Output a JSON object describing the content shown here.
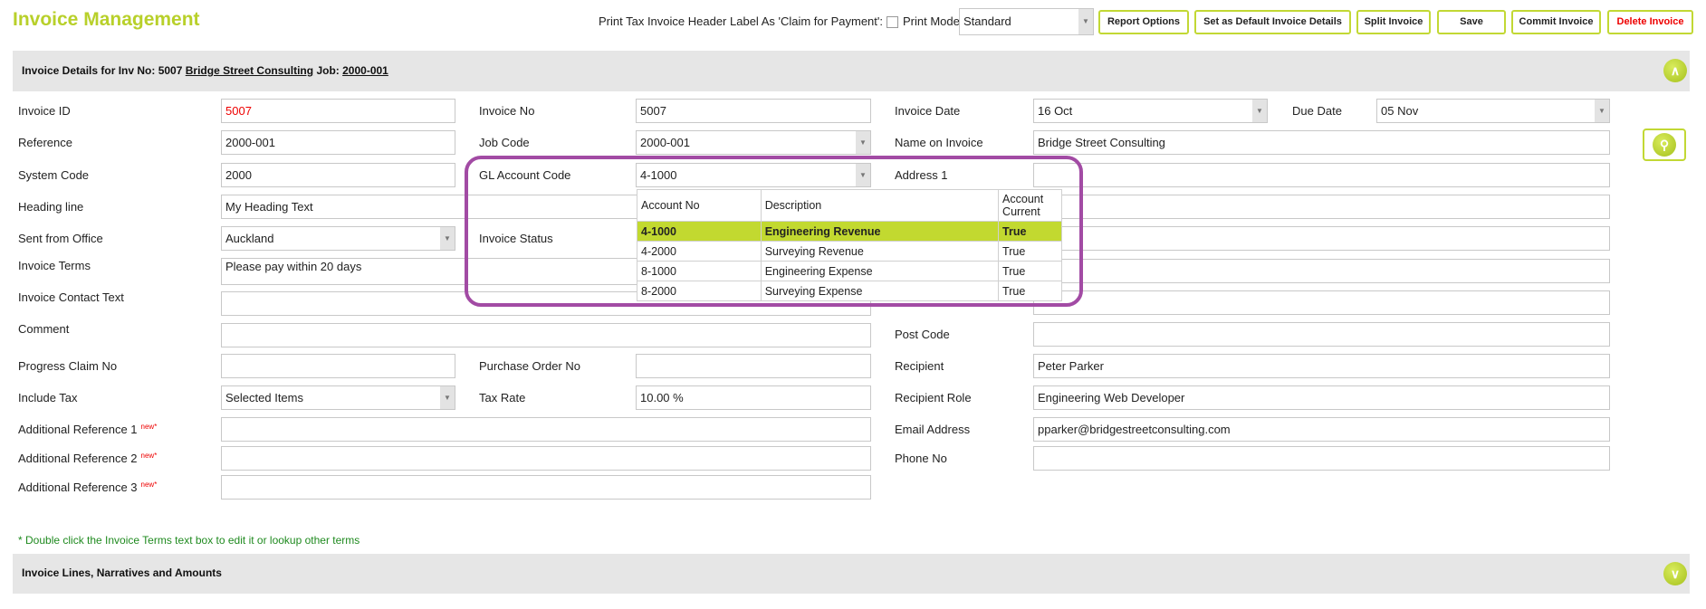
{
  "title": "Invoice Management",
  "toolbar": {
    "claim_label": "Print Tax Invoice Header Label As 'Claim for Payment':",
    "print_mode_label": "Print Mode:",
    "print_mode_value": "Standard",
    "buttons": [
      "Report Options",
      "Set as Default Invoice Details",
      "Split Invoice",
      "Save",
      "Commit Invoice",
      "Delete Invoice"
    ]
  },
  "details_header": {
    "prefix": "Invoice Details for Inv No: 5007",
    "client": "Bridge Street Consulting",
    "job_label": "Job:",
    "job": "2000-001"
  },
  "fields": {
    "invoice_id": {
      "label": "Invoice ID",
      "value": "5007"
    },
    "reference": {
      "label": "Reference",
      "value": "2000-001"
    },
    "system_code": {
      "label": "System Code",
      "value": "2000"
    },
    "heading_line": {
      "label": "Heading line",
      "value": "My Heading Text"
    },
    "sent_from_office": {
      "label": "Sent from Office",
      "value": "Auckland"
    },
    "invoice_terms": {
      "label": "Invoice Terms",
      "value": "Please pay within 20 days"
    },
    "invoice_contact_text": {
      "label": "Invoice Contact Text",
      "value": ""
    },
    "comment": {
      "label": "Comment",
      "value": ""
    },
    "progress_claim_no": {
      "label": "Progress Claim No",
      "value": ""
    },
    "include_tax": {
      "label": "Include Tax",
      "value": "Selected Items"
    },
    "additional_ref_1": {
      "label": "Additional Reference 1",
      "badge": "new*",
      "value": ""
    },
    "additional_ref_2": {
      "label": "Additional Reference 2",
      "badge": "new*",
      "value": ""
    },
    "additional_ref_3": {
      "label": "Additional Reference 3",
      "badge": "new*",
      "value": ""
    },
    "invoice_no": {
      "label": "Invoice No",
      "value": "5007"
    },
    "job_code": {
      "label": "Job Code",
      "value": "2000-001"
    },
    "gl_account_code": {
      "label": "GL Account Code",
      "value": "4-1000"
    },
    "invoice_status": {
      "label": "Invoice Status"
    },
    "purchase_order_no": {
      "label": "Purchase Order No",
      "value": ""
    },
    "tax_rate": {
      "label": "Tax Rate",
      "value": "10.00 %"
    },
    "invoice_date": {
      "label": "Invoice Date",
      "value": "16 Oct"
    },
    "due_date": {
      "label": "Due Date",
      "value": "05 Nov"
    },
    "name_on_invoice": {
      "label": "Name on Invoice",
      "value": "Bridge Street Consulting"
    },
    "address_1": {
      "label": "Address 1",
      "value": ""
    },
    "post_code": {
      "label": "Post Code",
      "value": ""
    },
    "recipient": {
      "label": "Recipient",
      "value": "Peter Parker"
    },
    "recipient_role": {
      "label": "Recipient Role",
      "value": "Engineering Web Developer"
    },
    "email_address": {
      "label": "Email Address",
      "value": "pparker@bridgestreetconsulting.com"
    },
    "phone_no": {
      "label": "Phone No",
      "value": ""
    }
  },
  "gl_dropdown": {
    "headers": [
      "Account No",
      "Description",
      "Account Current"
    ],
    "rows": [
      [
        "4-1000",
        "Engineering Revenue",
        "True"
      ],
      [
        "4-2000",
        "Surveying Revenue",
        "True"
      ],
      [
        "8-1000",
        "Engineering Expense",
        "True"
      ],
      [
        "8-2000",
        "Surveying Expense",
        "True"
      ]
    ]
  },
  "footnote": "* Double click the Invoice Terms text box to edit it or lookup other terms",
  "lines_header": "Invoice Lines, Narratives and Amounts",
  "colors": {
    "accent": "#c2d930",
    "highlight": "#a24ba4",
    "danger": "#e00000"
  }
}
